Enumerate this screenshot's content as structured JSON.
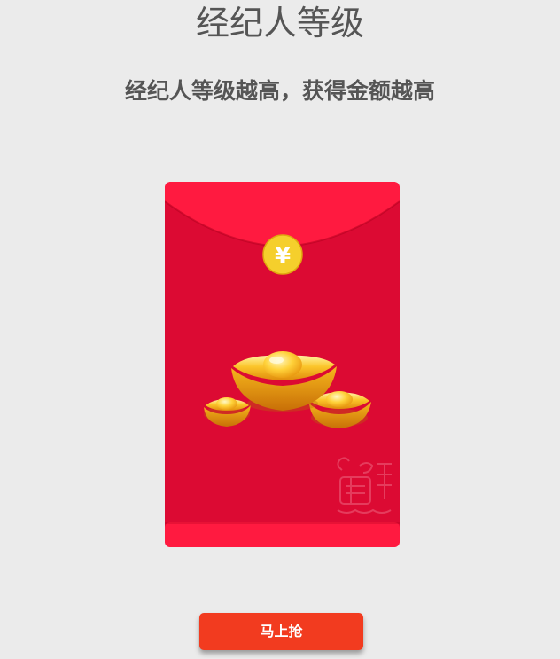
{
  "page": {
    "title": "经纪人等级",
    "subtitle": "经纪人等级越高，获得金额越高"
  },
  "envelope": {
    "seal_symbol": "¥",
    "icons": [
      "yen-seal-icon",
      "gold-ingot-icon",
      "goat-stamp-icon"
    ],
    "colors": {
      "body": "#dc0a33",
      "flap": "#ff1a40",
      "seal": "#f5cf2c",
      "gold": "#f7c028"
    }
  },
  "actions": {
    "grab_label": "马上抢"
  },
  "colors": {
    "background": "#ebebeb",
    "text": "#555555",
    "button": "#f23b1f"
  }
}
